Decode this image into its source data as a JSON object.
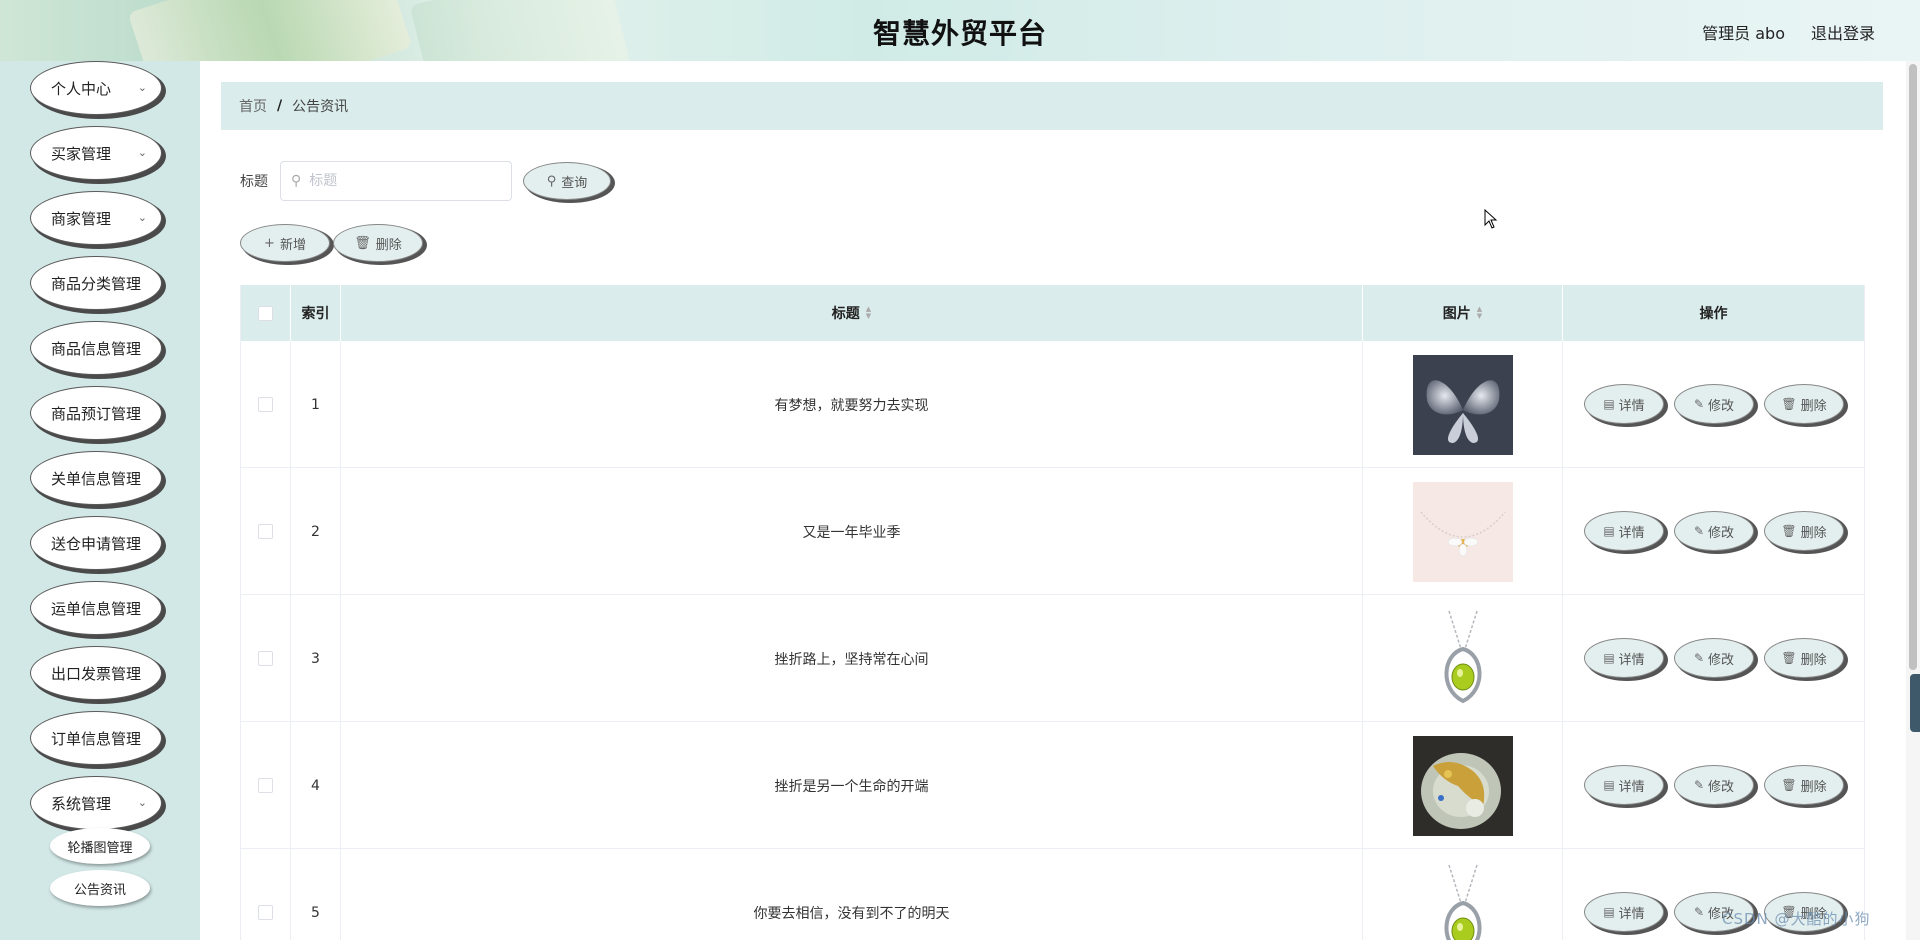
{
  "header": {
    "title": "智慧外贸平台",
    "user": "管理员 abo",
    "logout": "退出登录"
  },
  "sidebar": {
    "items": [
      {
        "label": "个人中心",
        "expandable": true
      },
      {
        "label": "买家管理",
        "expandable": true
      },
      {
        "label": "商家管理",
        "expandable": true
      },
      {
        "label": "商品分类管理",
        "expandable": false
      },
      {
        "label": "商品信息管理",
        "expandable": false
      },
      {
        "label": "商品预订管理",
        "expandable": false
      },
      {
        "label": "关单信息管理",
        "expandable": false
      },
      {
        "label": "送仓申请管理",
        "expandable": false
      },
      {
        "label": "运单信息管理",
        "expandable": false
      },
      {
        "label": "出口发票管理",
        "expandable": false
      },
      {
        "label": "订单信息管理",
        "expandable": false
      },
      {
        "label": "系统管理",
        "expandable": true
      }
    ],
    "sub_items": [
      {
        "label": "轮播图管理"
      },
      {
        "label": "公告资讯"
      }
    ]
  },
  "breadcrumb": {
    "home": "首页",
    "separator": "/",
    "current": "公告资讯"
  },
  "search": {
    "label": "标题",
    "placeholder": "标题",
    "value": "",
    "button": "查询"
  },
  "actions": {
    "add": "新增",
    "delete": "删除"
  },
  "table": {
    "headers": {
      "index": "索引",
      "title": "标题",
      "image": "图片",
      "ops": "操作"
    },
    "rows": [
      {
        "index": "1",
        "title": "有梦想，就要努力去实现",
        "image": "butterfly-brooch"
      },
      {
        "index": "2",
        "title": "又是一年毕业季",
        "image": "flower-necklace"
      },
      {
        "index": "3",
        "title": "挫折路上，坚持常在心间",
        "image": "peridot-pendant"
      },
      {
        "index": "4",
        "title": "挫折是另一个生命的开端",
        "image": "jade-ornament"
      },
      {
        "index": "5",
        "title": "你要去相信，没有到不了的明天",
        "image": "peridot-pendant"
      }
    ],
    "row_ops": {
      "detail": "详情",
      "edit": "修改",
      "delete": "删除"
    }
  },
  "icons": {
    "search": "search-icon",
    "add": "plus-icon",
    "delete": "trash-icon",
    "detail": "document-icon",
    "edit": "pencil-icon",
    "expand": "chevron-down-icon"
  },
  "colors": {
    "sidebar_bg": "#d2e8e7",
    "table_header_bg": "#daeceb",
    "button_bg": "#e3efee"
  },
  "watermark": "CSDN @大酷的小狗"
}
